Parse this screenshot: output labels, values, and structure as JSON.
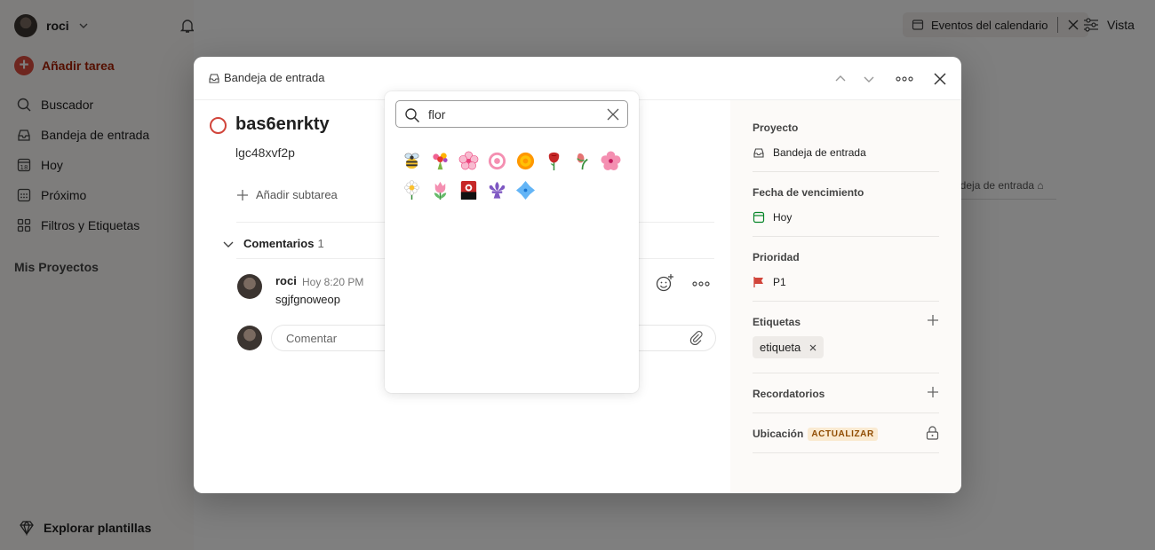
{
  "sidebar": {
    "user_name": "roci",
    "add_task": "Añadir tarea",
    "items": [
      {
        "label": "Buscador",
        "icon": "search-icon"
      },
      {
        "label": "Bandeja de entrada",
        "icon": "inbox-icon"
      },
      {
        "label": "Hoy",
        "icon": "calendar-today-icon"
      },
      {
        "label": "Próximo",
        "icon": "calendar-upcoming-icon"
      },
      {
        "label": "Filtros y Etiquetas",
        "icon": "filters-icon"
      }
    ],
    "projects_title": "Mis Proyectos",
    "explore": "Explorar plantillas"
  },
  "topbar": {
    "calendar_events": "Eventos del calendario",
    "view": "Vista",
    "bg_inbox_label": "ndeja de entrada"
  },
  "modal": {
    "breadcrumb": "Bandeja de entrada",
    "task": {
      "title": "bas6enrkty",
      "description": "lgc48xvf2p",
      "add_subtask": "Añadir subtarea"
    },
    "comments": {
      "label": "Comentarios",
      "count": "1",
      "items": [
        {
          "author": "roci",
          "time": "Hoy 8:20 PM",
          "text": "sgjfgnoweop"
        }
      ],
      "input_placeholder": "Comentar"
    },
    "details": {
      "project_label": "Proyecto",
      "project_value": "Bandeja de entrada",
      "due_label": "Fecha de vencimiento",
      "due_value": "Hoy",
      "priority_label": "Prioridad",
      "priority_value": "P1",
      "labels_label": "Etiquetas",
      "label_tag": "etiqueta",
      "reminders_label": "Recordatorios",
      "location_label": "Ubicación",
      "upgrade_badge": "ACTUALIZAR"
    }
  },
  "emoji_picker": {
    "query": "flor",
    "results": [
      "bee",
      "bouquet",
      "cherry-blossom",
      "white-flower",
      "rosette",
      "rose",
      "rosebud",
      "hibiscus",
      "daisy",
      "tulip",
      "flower-playing-cards",
      "fleur-de-lis",
      "diamond-with-dot"
    ]
  },
  "colors": {
    "accent": "#dc4c3e",
    "priority_flag": "#d1453b",
    "upgrade_bg": "#faead1",
    "due_green": "#058527"
  }
}
